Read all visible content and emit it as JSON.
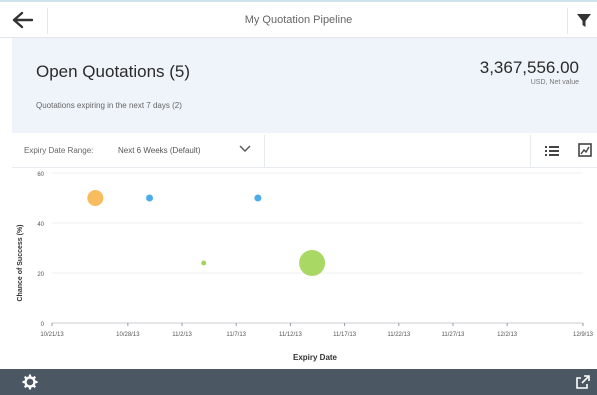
{
  "topbar": {
    "title": "My Quotation Pipeline"
  },
  "header": {
    "heading": "Open Quotations (5)",
    "amount": "3,367,556.00",
    "unit": "USD, Net value",
    "subtext": "Quotations expiring in the next 7 days (2)"
  },
  "toolbar": {
    "range_label": "Expiry Date Range:",
    "range_value": "Next 6 Weeks (Default)"
  },
  "chart_data": {
    "type": "scatter",
    "xlabel": "Expiry Date",
    "ylabel": "Chance of Success (%)",
    "ylim": [
      0,
      60
    ],
    "y_ticks": [
      "0",
      "20",
      "40",
      "60"
    ],
    "x_ticks": [
      "10/21/13",
      "10/28/13",
      "11/2/13",
      "11/7/13",
      "11/12/13",
      "11/17/13",
      "11/22/13",
      "11/27/13",
      "12/2/13",
      "12/9/13"
    ],
    "points": [
      {
        "x": "10/25/13",
        "y": 50,
        "size": "medium",
        "color": "#f5b041"
      },
      {
        "x": "10/30/13",
        "y": 50,
        "size": "small",
        "color": "#2e9fe6"
      },
      {
        "x": "11/4/13",
        "y": 24,
        "size": "tiny",
        "color": "#8fcf3c"
      },
      {
        "x": "11/9/13",
        "y": 50,
        "size": "small",
        "color": "#2e9fe6"
      },
      {
        "x": "11/14/13",
        "y": 24,
        "size": "large",
        "color": "#9bd14a"
      }
    ],
    "grid": true
  }
}
